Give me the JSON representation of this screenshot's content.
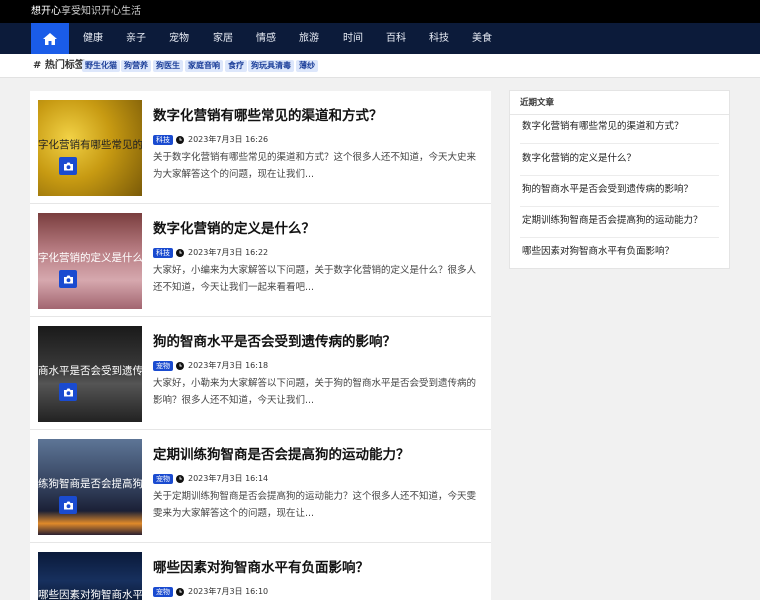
{
  "site": {
    "brand_main": "想开心",
    "brand_sub": "享受知识开心生活"
  },
  "nav": {
    "items": [
      "健康",
      "亲子",
      "宠物",
      "家居",
      "情感",
      "旅游",
      "时间",
      "百科",
      "科技",
      "美食"
    ],
    "home_icon": "home-icon"
  },
  "hot_tags": {
    "label": "# 热门标签",
    "tags": [
      "野生化猫",
      "狗营养",
      "狗医生",
      "家庭音响",
      "食疗",
      "狗玩具清毒",
      "薄纱"
    ]
  },
  "posts": [
    {
      "title": "数字化营销有哪些常见的渠道和方式？",
      "category": "科技",
      "date": "2023年7月3日 16:26",
      "excerpt": "关于数字化营销有哪些常见的渠道和方式？这个很多人还不知道，今天大史来为大家解答这个的问题，现在让我们...",
      "thumb_text": "字化营销有哪些常见的渠道和",
      "thumb_bg": "#c7a21a"
    },
    {
      "title": "数字化营销的定义是什么？",
      "category": "科技",
      "date": "2023年7月3日 16:22",
      "excerpt": "大家好，小编来为大家解答以下问题，关于数字化营销的定义是什么？很多人还不知道，今天让我们一起来看看吧...",
      "thumb_text": "字化营销的定义是什么",
      "thumb_bg": "#b67e85"
    },
    {
      "title": "狗的智商水平是否会受到遗传病的影响？",
      "category": "宠物",
      "date": "2023年7月3日 16:18",
      "excerpt": "大家好，小勒来为大家解答以下问题，关于狗的智商水平是否会受到遗传病的影响？很多人还不知道，今天让我们...",
      "thumb_text": "商水平是否会受到遗传病的",
      "thumb_bg": "#2b2b2b"
    },
    {
      "title": "定期训练狗智商是否会提高狗的运动能力？",
      "category": "宠物",
      "date": "2023年7月3日 16:14",
      "excerpt": "关于定期训练狗智商是否会提高狗的运动能力？这个很多人还不知道，今天雯雯来为大家解答这个的问题，现在让...",
      "thumb_text": "练狗智商是否会提高狗的运动",
      "thumb_bg": "#3c4c6a"
    },
    {
      "title": "哪些因素对狗智商水平有负面影响？",
      "category": "宠物",
      "date": "2023年7月3日 16:10",
      "excerpt": "",
      "thumb_text": "哪些因素对狗智商水平有负面",
      "thumb_bg": "#0d1d3a"
    }
  ],
  "recent": {
    "heading": "近期文章",
    "items": [
      "数字化营销有哪些常见的渠道和方式？",
      "数字化营销的定义是什么？",
      "狗的智商水平是否会受到遗传病的影响？",
      "定期训练狗智商是否会提高狗的运动能力？",
      "哪些因素对狗智商水平有负面影响？"
    ]
  },
  "colors": {
    "accent": "#1a4bd0",
    "nav_bg": "#0c1b3a",
    "topbar_bg": "#000000"
  }
}
